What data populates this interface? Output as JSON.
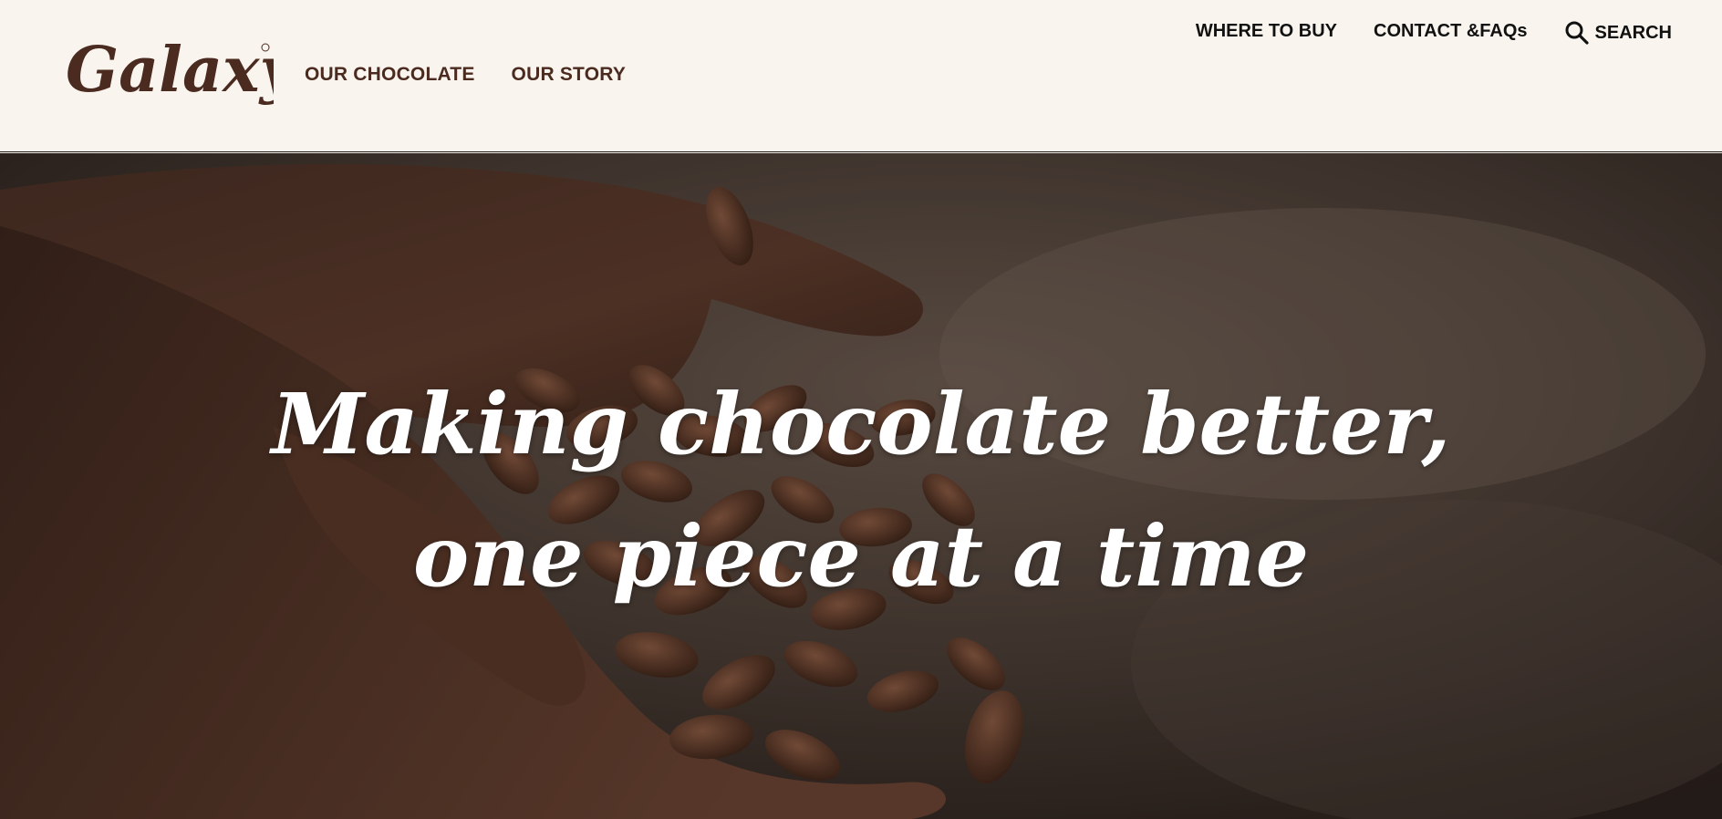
{
  "brand": {
    "name": "Galaxy",
    "color": "#4b2a1f"
  },
  "nav": {
    "primary": [
      {
        "label": "OUR CHOCOLATE"
      },
      {
        "label": "OUR STORY"
      }
    ],
    "utility": [
      {
        "label": "WHERE TO BUY"
      },
      {
        "label": "CONTACT &FAQs"
      }
    ],
    "search_label": "SEARCH"
  },
  "hero": {
    "line1": "Making chocolate better,",
    "line2": "one piece at a time"
  },
  "colors": {
    "header_bg": "#f9f5ee",
    "nav_text": "#4b2a1f",
    "utility_text": "#111111",
    "hero_text": "#ffffff"
  }
}
